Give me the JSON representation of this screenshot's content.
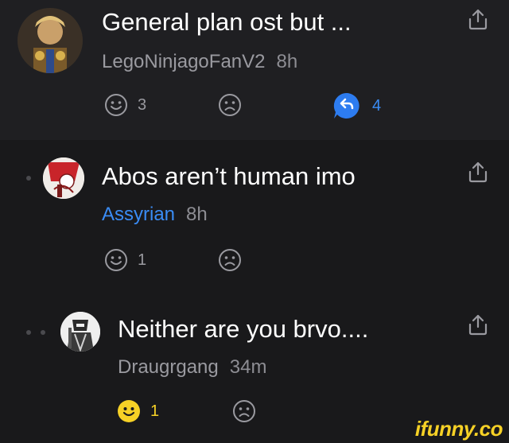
{
  "comments": [
    {
      "title": "General plan ost but ...",
      "author": "LegoNinjagoFanV2",
      "time": "8h",
      "smile_count": "3",
      "reply_count": "4"
    },
    {
      "title": "Abos aren’t human imo",
      "author": "Assyrian",
      "time": "8h",
      "smile_count": "1"
    },
    {
      "title": "Neither are you brvo....",
      "author": "Draugrgang",
      "time": "34m",
      "smile_count": "1"
    }
  ],
  "watermark": "ifunny.co",
  "colors": {
    "background": "#1c1c1e",
    "author_highlight": "#3a8cf5",
    "reply_badge": "#2d7cf0",
    "active_smile": "#f6d126",
    "muted": "#9a9aa0"
  },
  "icons": [
    "smile-icon",
    "frown-icon",
    "reply-icon",
    "share-icon"
  ]
}
